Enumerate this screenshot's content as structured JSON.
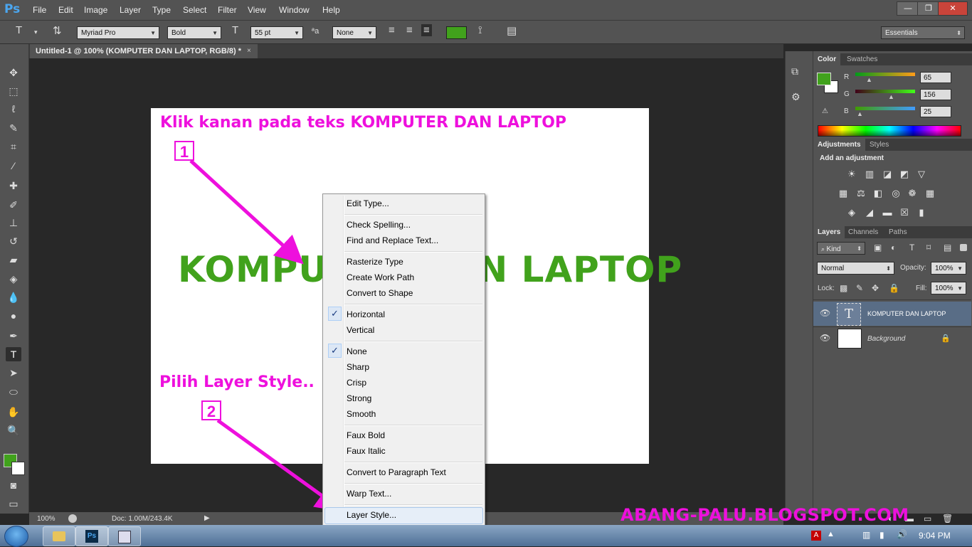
{
  "app": {
    "logo": "Ps"
  },
  "menubar": [
    "File",
    "Edit",
    "Image",
    "Layer",
    "Type",
    "Select",
    "Filter",
    "View",
    "Window",
    "Help"
  ],
  "window_controls": {
    "minimize": "—",
    "restore": "❐",
    "close": "✕"
  },
  "options_bar": {
    "font_family": "Myriad Pro",
    "font_style": "Bold",
    "font_size": "55 pt",
    "antialias": "None",
    "text_color": "#41a21c",
    "workspace": "Essentials"
  },
  "document": {
    "tab_title": "Untitled-1 @ 100% (KOMPUTER DAN LAPTOP, RGB/8) *",
    "close": "×",
    "canvas_text": "KOMPUTER DAN LAPTOP",
    "zoom": "100%",
    "doc_info": "Doc: 1.00M/243.4K"
  },
  "annotations": {
    "instruction_1": "Klik kanan pada teks KOMPUTER DAN LAPTOP",
    "number_1": "1",
    "instruction_2": "Pilih Layer Style..",
    "number_2": "2",
    "watermark": "ABANG-PALU.BLOGSPOT.COM",
    "color": "#ee10dd"
  },
  "context_menu": {
    "items": [
      "Edit Type...",
      "Check Spelling...",
      "Find and Replace Text...",
      "Rasterize Type",
      "Create Work Path",
      "Convert to Shape",
      "Horizontal",
      "Vertical",
      "None",
      "Sharp",
      "Crisp",
      "Strong",
      "Smooth",
      "Faux Bold",
      "Faux Italic",
      "Convert to Paragraph Text",
      "Warp Text...",
      "Layer Style..."
    ],
    "checked": [
      "Horizontal",
      "None"
    ],
    "highlighted": "Layer Style...",
    "checkmark": "✓"
  },
  "color_panel": {
    "tabs": [
      "Color",
      "Swatches"
    ],
    "r_label": "R",
    "g_label": "G",
    "b_label": "B",
    "r": "65",
    "g": "156",
    "b": "25",
    "foreground": "#41a21c"
  },
  "adjustments_panel": {
    "tabs": [
      "Adjustments",
      "Styles"
    ],
    "heading": "Add an adjustment"
  },
  "layers_panel": {
    "tabs": [
      "Layers",
      "Channels",
      "Paths"
    ],
    "filter_kind": "Kind",
    "blend_mode": "Normal",
    "opacity_label": "Opacity:",
    "opacity": "100%",
    "lock_label": "Lock:",
    "fill_label": "Fill:",
    "fill": "100%",
    "layers": [
      {
        "name": "KOMPUTER DAN LAPTOP",
        "thumb": "T",
        "selected": true
      },
      {
        "name": "Background",
        "thumb": "",
        "selected": false
      }
    ]
  },
  "taskbar": {
    "clock": "9:04 PM",
    "ps_label": "Ps"
  }
}
